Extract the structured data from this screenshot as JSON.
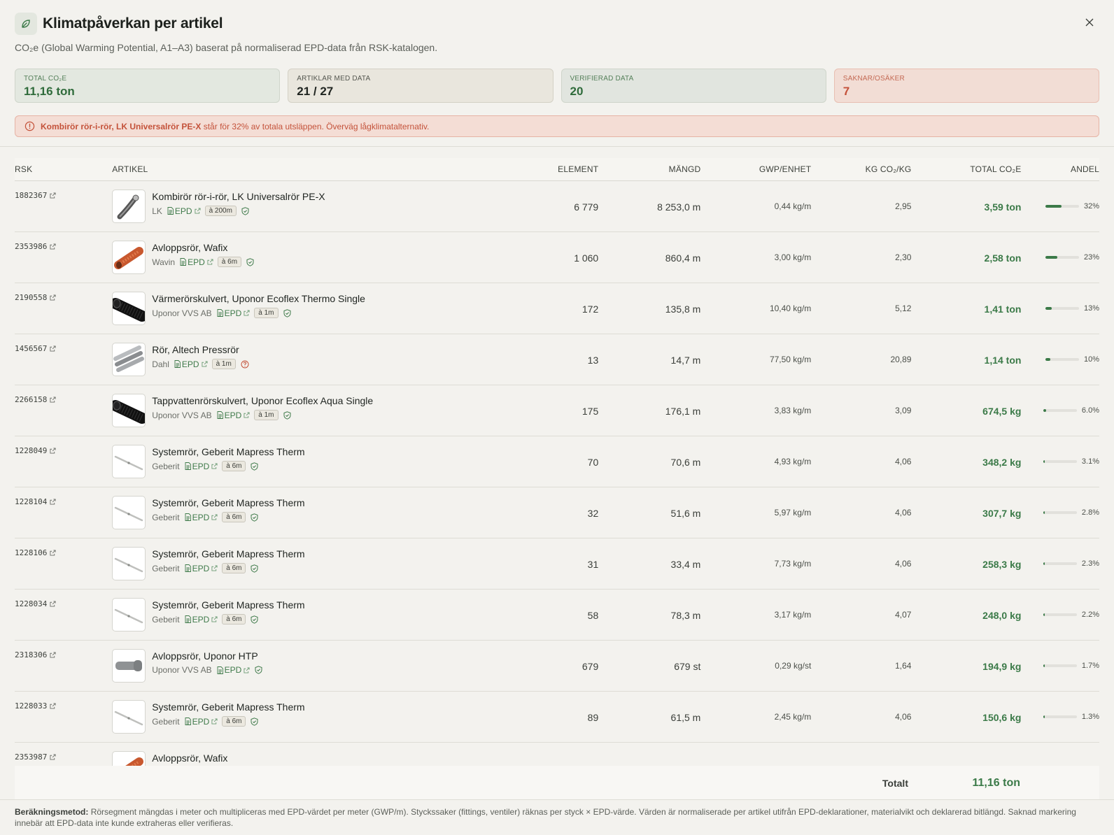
{
  "dialog": {
    "title": "Klimatpåverkan per artikel",
    "subtitle": "CO₂e (Global Warming Potential, A1–A3) baserat på normaliserad EPD-data från RSK-katalogen.",
    "close_label": "×"
  },
  "stats": {
    "total_label": "TOTAL CO₂E",
    "total_value": "11,16 ton",
    "articles_label": "ARTIKLAR MED DATA",
    "articles_value": "21 / 27",
    "verified_label": "VERIFIERAD DATA",
    "verified_value": "20",
    "missing_label": "SAKNAR/OSÄKER",
    "missing_value": "7"
  },
  "alert": {
    "highlight": "Kombirör rör-i-rör, LK Universalrör PE-X",
    "text": " står för 32% av totala utsläppen. Överväg lågklimatalternativ."
  },
  "table": {
    "headers": {
      "rsk": "RSK",
      "artikel": "ARTIKEL",
      "element": "ELEMENT",
      "mangd": "MÄNGD",
      "gwp": "GWP/ENHET",
      "kg": "KG CO₂/KG",
      "total": "TOTAL CO₂E",
      "andel": "ANDEL"
    },
    "epd_label": "EPD",
    "rows": [
      {
        "rsk": "1882367",
        "name": "Kombirör rör-i-rör, LK Universalrör PE-X",
        "brand": "LK",
        "badge": "à 200m",
        "status": "verified",
        "element": "6 779",
        "mangd": "8 253,0 m",
        "gwp": "0,44 kg/m",
        "kg": "2,95",
        "total": "3,59 ton",
        "andel": "32%",
        "share": 0.32,
        "thumb": "coil"
      },
      {
        "rsk": "2353986",
        "name": "Avloppsrör, Wafix",
        "brand": "Wavin",
        "badge": "à 6m",
        "status": "verified",
        "element": "1 060",
        "mangd": "860,4 m",
        "gwp": "3,00 kg/m",
        "kg": "2,30",
        "total": "2,58 ton",
        "andel": "23%",
        "share": 0.23,
        "thumb": "orange"
      },
      {
        "rsk": "2190558",
        "name": "Värmerörskulvert, Uponor Ecoflex Thermo Single",
        "brand": "Uponor VVS AB",
        "badge": "à 1m",
        "status": "verified",
        "element": "172",
        "mangd": "135,8 m",
        "gwp": "10,40 kg/m",
        "kg": "5,12",
        "total": "1,41 ton",
        "andel": "13%",
        "share": 0.13,
        "thumb": "black"
      },
      {
        "rsk": "1456567",
        "name": "Rör, Altech Pressrör",
        "brand": "Dahl",
        "badge": "à 1m",
        "status": "unknown",
        "element": "13",
        "mangd": "14,7 m",
        "gwp": "77,50 kg/m",
        "kg": "20,89",
        "total": "1,14 ton",
        "andel": "10%",
        "share": 0.1,
        "thumb": "steel"
      },
      {
        "rsk": "2266158",
        "name": "Tappvattenrörskulvert, Uponor Ecoflex Aqua Single",
        "brand": "Uponor VVS AB",
        "badge": "à 1m",
        "status": "verified",
        "element": "175",
        "mangd": "176,1 m",
        "gwp": "3,83 kg/m",
        "kg": "3,09",
        "total": "674,5 kg",
        "andel": "6.0%",
        "share": 0.06,
        "thumb": "black"
      },
      {
        "rsk": "1228049",
        "name": "Systemrör, Geberit Mapress Therm",
        "brand": "Geberit",
        "badge": "à 6m",
        "status": "verified",
        "element": "70",
        "mangd": "70,6 m",
        "gwp": "4,93 kg/m",
        "kg": "4,06",
        "total": "348,2 kg",
        "andel": "3.1%",
        "share": 0.031,
        "thumb": "thin"
      },
      {
        "rsk": "1228104",
        "name": "Systemrör, Geberit Mapress Therm",
        "brand": "Geberit",
        "badge": "à 6m",
        "status": "verified",
        "element": "32",
        "mangd": "51,6 m",
        "gwp": "5,97 kg/m",
        "kg": "4,06",
        "total": "307,7 kg",
        "andel": "2.8%",
        "share": 0.028,
        "thumb": "thin"
      },
      {
        "rsk": "1228106",
        "name": "Systemrör, Geberit Mapress Therm",
        "brand": "Geberit",
        "badge": "à 6m",
        "status": "verified",
        "element": "31",
        "mangd": "33,4 m",
        "gwp": "7,73 kg/m",
        "kg": "4,06",
        "total": "258,3 kg",
        "andel": "2.3%",
        "share": 0.023,
        "thumb": "thin"
      },
      {
        "rsk": "1228034",
        "name": "Systemrör, Geberit Mapress Therm",
        "brand": "Geberit",
        "badge": "à 6m",
        "status": "verified",
        "element": "58",
        "mangd": "78,3 m",
        "gwp": "3,17 kg/m",
        "kg": "4,07",
        "total": "248,0 kg",
        "andel": "2.2%",
        "share": 0.022,
        "thumb": "thin"
      },
      {
        "rsk": "2318306",
        "name": "Avloppsrör, Uponor HTP",
        "brand": "Uponor VVS AB",
        "badge": "",
        "status": "verified",
        "element": "679",
        "mangd": "679 st",
        "gwp": "0,29 kg/st",
        "kg": "1,64",
        "total": "194,9 kg",
        "andel": "1.7%",
        "share": 0.017,
        "thumb": "grey"
      },
      {
        "rsk": "1228033",
        "name": "Systemrör, Geberit Mapress Therm",
        "brand": "Geberit",
        "badge": "à 6m",
        "status": "verified",
        "element": "89",
        "mangd": "61,5 m",
        "gwp": "2,45 kg/m",
        "kg": "4,06",
        "total": "150,6 kg",
        "andel": "1.3%",
        "share": 0.013,
        "thumb": "thin"
      },
      {
        "rsk": "2353987",
        "name": "Avloppsrör, Wafix",
        "brand": "",
        "badge": "",
        "status": "",
        "element": "",
        "mangd": "",
        "gwp": "",
        "kg": "",
        "total": "",
        "andel": "",
        "share": 0,
        "thumb": "orange"
      }
    ]
  },
  "totals": {
    "label": "Totalt",
    "value": "11,16 ton"
  },
  "footer": {
    "method_label": "Beräkningsmetod:",
    "method_text": " Rörsegment mängdas i meter och multipliceras med EPD-värdet per meter (GWP/m). Styckssaker (fittings, ventiler) räknas per styck × EPD-värde. Värden är normaliserade per artikel utifrån EPD-deklarationer, materialvikt och deklarerad bitlängd. Saknad markering innebär att EPD-data inte kunde extraheras eller verifieras."
  },
  "colors": {
    "accent_green": "#3b7a48",
    "warning_red": "#c4523a",
    "background": "#f3f2ee"
  }
}
